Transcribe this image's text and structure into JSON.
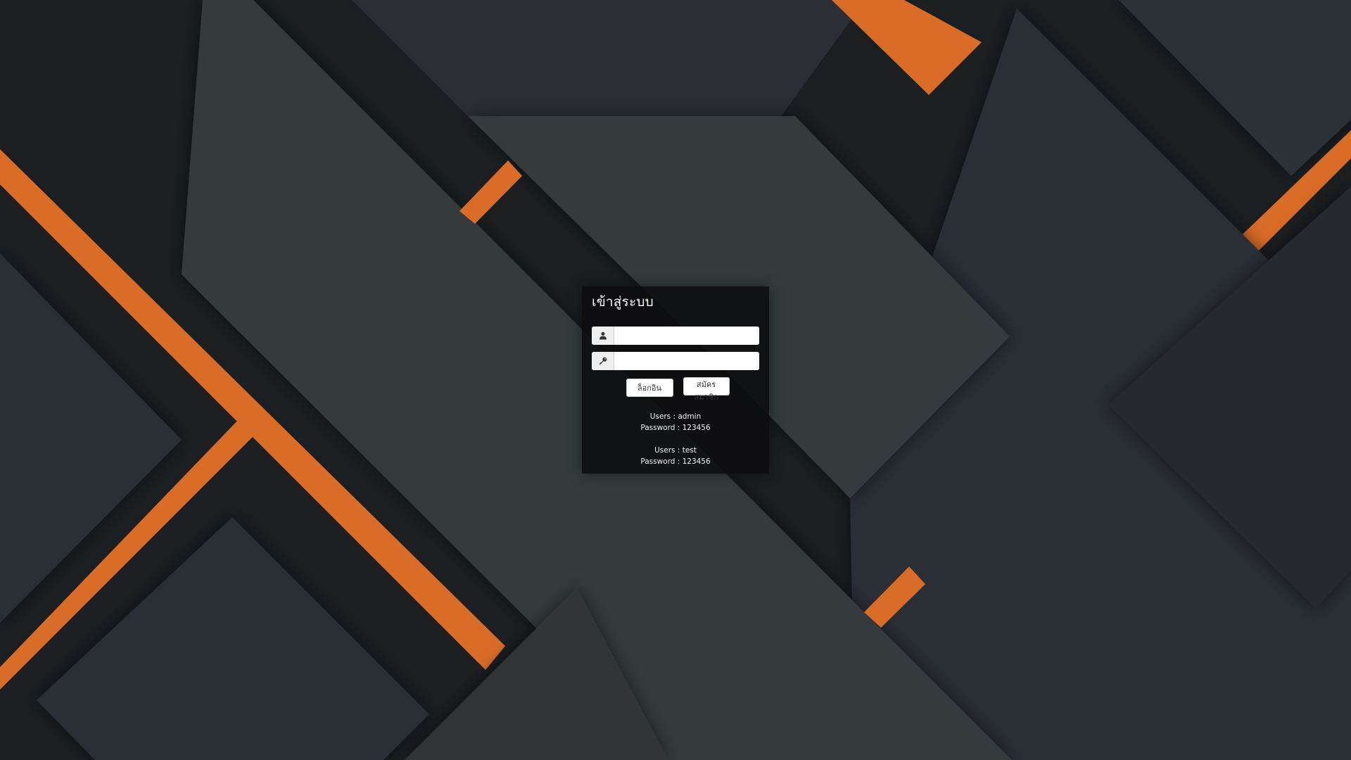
{
  "theme": {
    "accent": "#d96c27",
    "background_dark": "#1b1f22",
    "background_mid": "#2a2e33",
    "background_light": "#363a3e",
    "panel": "#0c0d0e"
  },
  "login": {
    "title": "เข้าสู่ระบบ",
    "username": {
      "icon": "user-icon",
      "value": "",
      "placeholder": ""
    },
    "password": {
      "icon": "key-icon",
      "value": "",
      "placeholder": ""
    },
    "login_label": "ล็อกอิน",
    "register_label": "สมัครสมาชิก"
  },
  "demo_accounts": [
    {
      "user_line": "Users : admin",
      "password_line": "Password : 123456"
    },
    {
      "user_line": "Users : test",
      "password_line": "Password : 123456"
    }
  ]
}
